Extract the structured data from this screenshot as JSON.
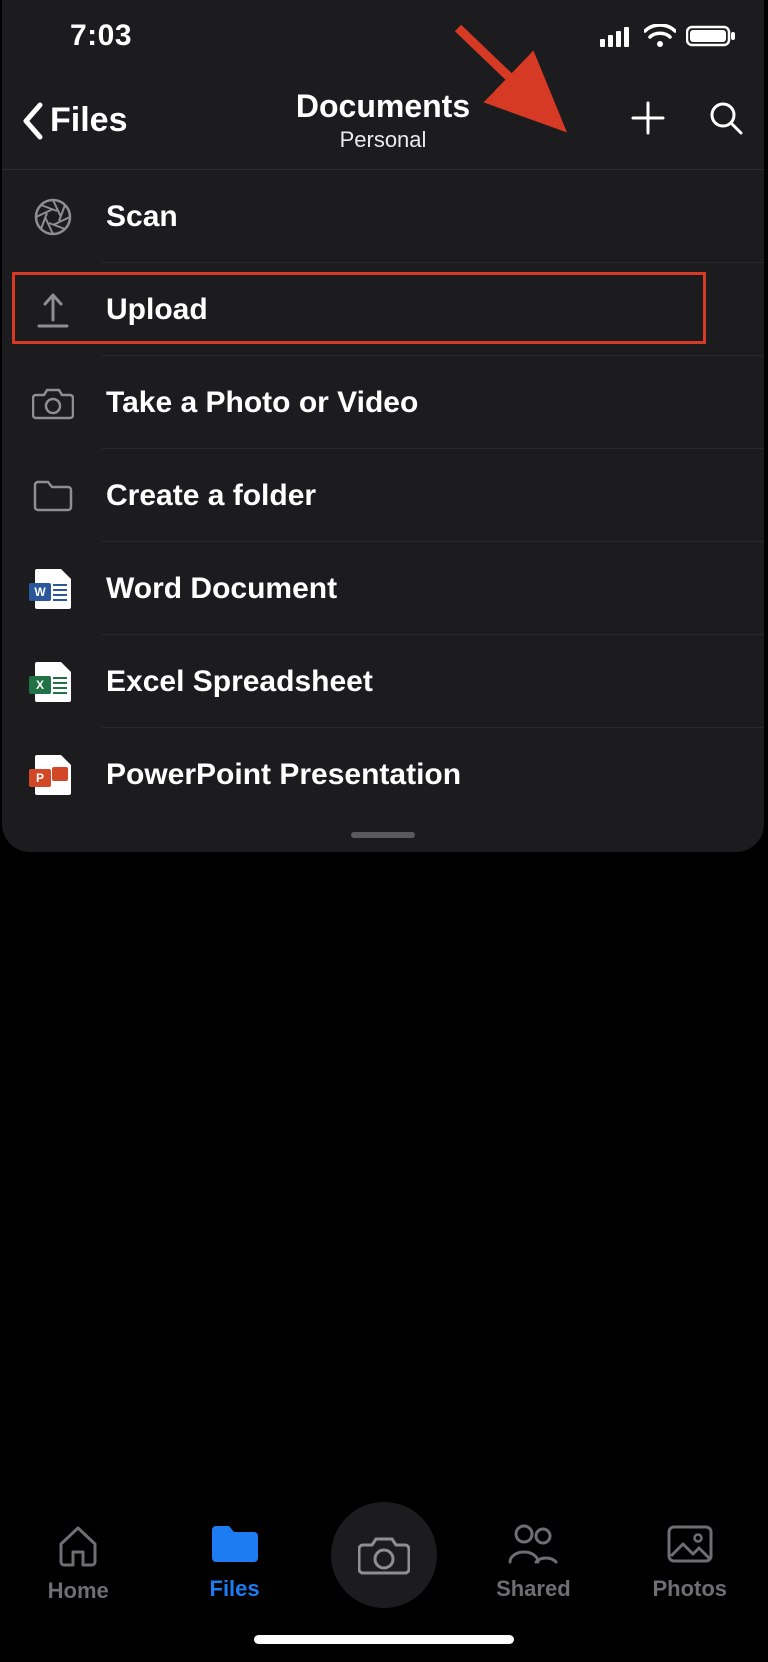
{
  "status": {
    "time": "7:03"
  },
  "nav": {
    "back_label": "Files",
    "title": "Documents",
    "subtitle": "Personal"
  },
  "menu": {
    "items": [
      {
        "label": "Scan"
      },
      {
        "label": "Upload"
      },
      {
        "label": "Take a Photo or Video"
      },
      {
        "label": "Create a folder"
      },
      {
        "label": "Word Document"
      },
      {
        "label": "Excel Spreadsheet"
      },
      {
        "label": "PowerPoint Presentation"
      }
    ],
    "highlighted_index": 1
  },
  "tabs": {
    "home": "Home",
    "files": "Files",
    "shared": "Shared",
    "photos": "Photos",
    "active": "files"
  },
  "colors": {
    "highlight_border": "#d63a24",
    "accent_blue": "#1d7cf2",
    "panel_bg": "#1c1c1e"
  }
}
